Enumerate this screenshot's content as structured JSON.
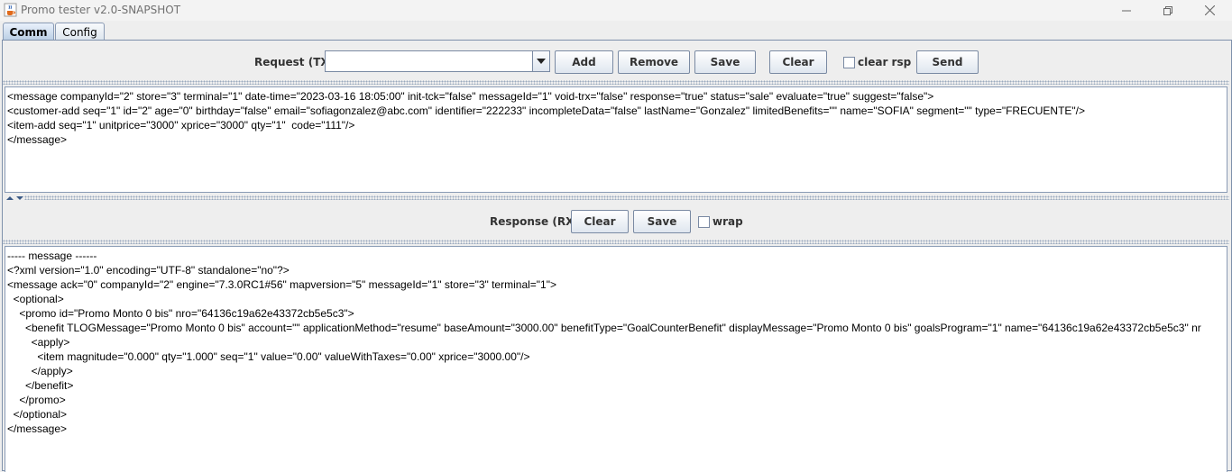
{
  "window": {
    "title": "Promo tester v2.0-SNAPSHOT",
    "icons": {
      "app": "java-cup-icon",
      "minimize": "minimize-icon",
      "maximize": "restore-icon",
      "close": "close-icon"
    }
  },
  "tabs": [
    {
      "label": "Comm",
      "active": true
    },
    {
      "label": "Config",
      "active": false
    }
  ],
  "request": {
    "label": "Request (TX)",
    "combo_value": "",
    "buttons": {
      "add": "Add",
      "remove": "Remove",
      "save": "Save",
      "clear": "Clear",
      "send": "Send"
    },
    "clear_rsp_label": "clear rsp",
    "clear_rsp_checked": false,
    "lines": [
      "<message companyId=\"2\" store=\"3\" terminal=\"1\" date-time=\"2023-03-16 18:05:00\" init-tck=\"false\" messageId=\"1\" void-trx=\"false\" response=\"true\" status=\"sale\" evaluate=\"true\" suggest=\"false\">",
      "<customer-add seq=\"1\" id=\"2\" age=\"0\" birthday=\"false\" email=\"sofiagonzalez@abc.com\" identifier=\"222233\" incompleteData=\"false\" lastName=\"Gonzalez\" limitedBenefits=\"\" name=\"SOFIA\" segment=\"\" type=\"FRECUENTE\"/>",
      "<item-add seq=\"1\" unitprice=\"3000\" xprice=\"3000\" qty=\"1\"  code=\"111\"/>",
      "</message>"
    ]
  },
  "response": {
    "label": "Response (RX)",
    "buttons": {
      "clear": "Clear",
      "save": "Save"
    },
    "wrap_label": "wrap",
    "wrap_checked": false,
    "lines": [
      "----- message ------",
      "<?xml version=\"1.0\" encoding=\"UTF-8\" standalone=\"no\"?>",
      "<message ack=\"0\" companyId=\"2\" engine=\"7.3.0RC1#56\" mapversion=\"5\" messageId=\"1\" store=\"3\" terminal=\"1\">",
      "  <optional>",
      "    <promo id=\"Promo Monto 0 bis\" nro=\"64136c19a62e43372cb5e5c3\">",
      "      <benefit TLOGMessage=\"Promo Monto 0 bis\" account=\"\" applicationMethod=\"resume\" baseAmount=\"3000.00\" benefitType=\"GoalCounterBenefit\" displayMessage=\"Promo Monto 0 bis\" goalsProgram=\"1\" name=\"64136c19a62e43372cb5e5c3\" nr",
      "        <apply>",
      "          <item magnitude=\"0.000\" qty=\"1.000\" seq=\"1\" value=\"0.00\" valueWithTaxes=\"0.00\" xprice=\"3000.00\"/>",
      "        </apply>",
      "      </benefit>",
      "    </promo>",
      "  </optional>",
      "</message>"
    ]
  }
}
